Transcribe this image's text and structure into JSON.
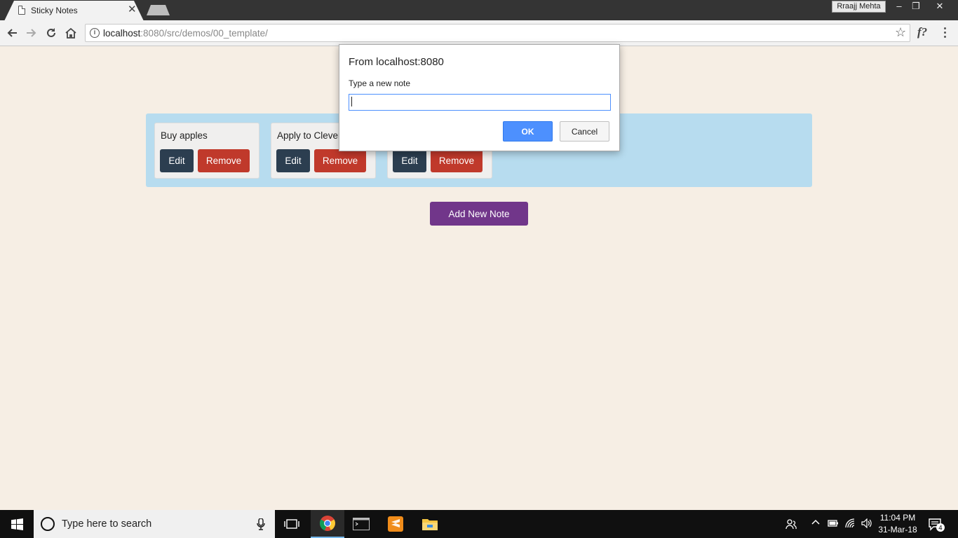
{
  "browser": {
    "tab_title": "Sticky Notes",
    "tab_close": "✕",
    "profile_name": "Rraajj Mehta",
    "window_controls": [
      "–",
      "❐",
      "✕"
    ],
    "url_host": "localhost",
    "url_rest": ":8080/src/demos/00_template/",
    "extension_label": "f?"
  },
  "app": {
    "notes": [
      {
        "text": "Buy apples",
        "edit_label": "Edit",
        "remove_label": "Remove"
      },
      {
        "text": "Apply to Clever",
        "edit_label": "Edit",
        "remove_label": "Remove"
      },
      {
        "text": "",
        "edit_label": "Edit",
        "remove_label": "Remove"
      }
    ],
    "add_button_label": "Add New Note"
  },
  "dialog": {
    "title": "From localhost:8080",
    "message": "Type a new note",
    "input_value": "",
    "ok_label": "OK",
    "cancel_label": "Cancel"
  },
  "taskbar": {
    "search_placeholder": "Type here to search",
    "time": "11:04 PM",
    "date": "31-Mar-18",
    "notification_count": "4"
  },
  "colors": {
    "page_bg": "#f6eee4",
    "board_bg": "#b7dcef",
    "edit_btn": "#2c3e50",
    "remove_btn": "#c0392b",
    "add_btn": "#71368a",
    "ok_btn": "#4d90fe"
  }
}
